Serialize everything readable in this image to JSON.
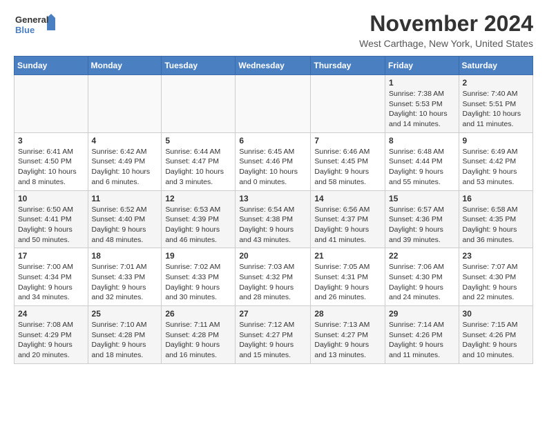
{
  "logo": {
    "line1": "General",
    "line2": "Blue"
  },
  "title": "November 2024",
  "location": "West Carthage, New York, United States",
  "days_of_week": [
    "Sunday",
    "Monday",
    "Tuesday",
    "Wednesday",
    "Thursday",
    "Friday",
    "Saturday"
  ],
  "weeks": [
    [
      {
        "day": "",
        "info": ""
      },
      {
        "day": "",
        "info": ""
      },
      {
        "day": "",
        "info": ""
      },
      {
        "day": "",
        "info": ""
      },
      {
        "day": "",
        "info": ""
      },
      {
        "day": "1",
        "info": "Sunrise: 7:38 AM\nSunset: 5:53 PM\nDaylight: 10 hours and 14 minutes."
      },
      {
        "day": "2",
        "info": "Sunrise: 7:40 AM\nSunset: 5:51 PM\nDaylight: 10 hours and 11 minutes."
      }
    ],
    [
      {
        "day": "3",
        "info": "Sunrise: 6:41 AM\nSunset: 4:50 PM\nDaylight: 10 hours and 8 minutes."
      },
      {
        "day": "4",
        "info": "Sunrise: 6:42 AM\nSunset: 4:49 PM\nDaylight: 10 hours and 6 minutes."
      },
      {
        "day": "5",
        "info": "Sunrise: 6:44 AM\nSunset: 4:47 PM\nDaylight: 10 hours and 3 minutes."
      },
      {
        "day": "6",
        "info": "Sunrise: 6:45 AM\nSunset: 4:46 PM\nDaylight: 10 hours and 0 minutes."
      },
      {
        "day": "7",
        "info": "Sunrise: 6:46 AM\nSunset: 4:45 PM\nDaylight: 9 hours and 58 minutes."
      },
      {
        "day": "8",
        "info": "Sunrise: 6:48 AM\nSunset: 4:44 PM\nDaylight: 9 hours and 55 minutes."
      },
      {
        "day": "9",
        "info": "Sunrise: 6:49 AM\nSunset: 4:42 PM\nDaylight: 9 hours and 53 minutes."
      }
    ],
    [
      {
        "day": "10",
        "info": "Sunrise: 6:50 AM\nSunset: 4:41 PM\nDaylight: 9 hours and 50 minutes."
      },
      {
        "day": "11",
        "info": "Sunrise: 6:52 AM\nSunset: 4:40 PM\nDaylight: 9 hours and 48 minutes."
      },
      {
        "day": "12",
        "info": "Sunrise: 6:53 AM\nSunset: 4:39 PM\nDaylight: 9 hours and 46 minutes."
      },
      {
        "day": "13",
        "info": "Sunrise: 6:54 AM\nSunset: 4:38 PM\nDaylight: 9 hours and 43 minutes."
      },
      {
        "day": "14",
        "info": "Sunrise: 6:56 AM\nSunset: 4:37 PM\nDaylight: 9 hours and 41 minutes."
      },
      {
        "day": "15",
        "info": "Sunrise: 6:57 AM\nSunset: 4:36 PM\nDaylight: 9 hours and 39 minutes."
      },
      {
        "day": "16",
        "info": "Sunrise: 6:58 AM\nSunset: 4:35 PM\nDaylight: 9 hours and 36 minutes."
      }
    ],
    [
      {
        "day": "17",
        "info": "Sunrise: 7:00 AM\nSunset: 4:34 PM\nDaylight: 9 hours and 34 minutes."
      },
      {
        "day": "18",
        "info": "Sunrise: 7:01 AM\nSunset: 4:33 PM\nDaylight: 9 hours and 32 minutes."
      },
      {
        "day": "19",
        "info": "Sunrise: 7:02 AM\nSunset: 4:33 PM\nDaylight: 9 hours and 30 minutes."
      },
      {
        "day": "20",
        "info": "Sunrise: 7:03 AM\nSunset: 4:32 PM\nDaylight: 9 hours and 28 minutes."
      },
      {
        "day": "21",
        "info": "Sunrise: 7:05 AM\nSunset: 4:31 PM\nDaylight: 9 hours and 26 minutes."
      },
      {
        "day": "22",
        "info": "Sunrise: 7:06 AM\nSunset: 4:30 PM\nDaylight: 9 hours and 24 minutes."
      },
      {
        "day": "23",
        "info": "Sunrise: 7:07 AM\nSunset: 4:30 PM\nDaylight: 9 hours and 22 minutes."
      }
    ],
    [
      {
        "day": "24",
        "info": "Sunrise: 7:08 AM\nSunset: 4:29 PM\nDaylight: 9 hours and 20 minutes."
      },
      {
        "day": "25",
        "info": "Sunrise: 7:10 AM\nSunset: 4:28 PM\nDaylight: 9 hours and 18 minutes."
      },
      {
        "day": "26",
        "info": "Sunrise: 7:11 AM\nSunset: 4:28 PM\nDaylight: 9 hours and 16 minutes."
      },
      {
        "day": "27",
        "info": "Sunrise: 7:12 AM\nSunset: 4:27 PM\nDaylight: 9 hours and 15 minutes."
      },
      {
        "day": "28",
        "info": "Sunrise: 7:13 AM\nSunset: 4:27 PM\nDaylight: 9 hours and 13 minutes."
      },
      {
        "day": "29",
        "info": "Sunrise: 7:14 AM\nSunset: 4:26 PM\nDaylight: 9 hours and 11 minutes."
      },
      {
        "day": "30",
        "info": "Sunrise: 7:15 AM\nSunset: 4:26 PM\nDaylight: 9 hours and 10 minutes."
      }
    ]
  ]
}
